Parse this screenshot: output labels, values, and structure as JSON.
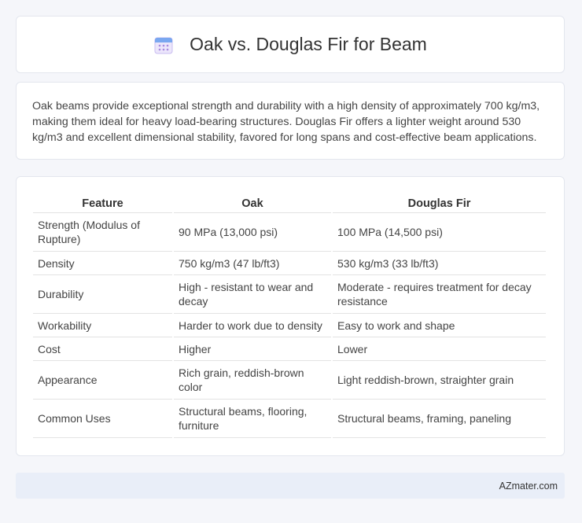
{
  "header": {
    "title": "Oak vs. Douglas Fir for Beam",
    "icon": "calendar-icon"
  },
  "summary": "Oak beams provide exceptional strength and durability with a high density of approximately 700 kg/m3, making them ideal for heavy load-bearing structures. Douglas Fir offers a lighter weight around 530 kg/m3 and excellent dimensional stability, favored for long spans and cost-effective beam applications.",
  "table": {
    "headers": [
      "Feature",
      "Oak",
      "Douglas Fir"
    ],
    "rows": [
      [
        "Strength (Modulus of Rupture)",
        "90 MPa (13,000 psi)",
        "100 MPa (14,500 psi)"
      ],
      [
        "Density",
        "750 kg/m3 (47 lb/ft3)",
        "530 kg/m3 (33 lb/ft3)"
      ],
      [
        "Durability",
        "High - resistant to wear and decay",
        "Moderate - requires treatment for decay resistance"
      ],
      [
        "Workability",
        "Harder to work due to density",
        "Easy to work and shape"
      ],
      [
        "Cost",
        "Higher",
        "Lower"
      ],
      [
        "Appearance",
        "Rich grain, reddish-brown color",
        "Light reddish-brown, straighter grain"
      ],
      [
        "Common Uses",
        "Structural beams, flooring, furniture",
        "Structural beams, framing, paneling"
      ]
    ]
  },
  "footer": {
    "brand": "AZmater.com"
  }
}
